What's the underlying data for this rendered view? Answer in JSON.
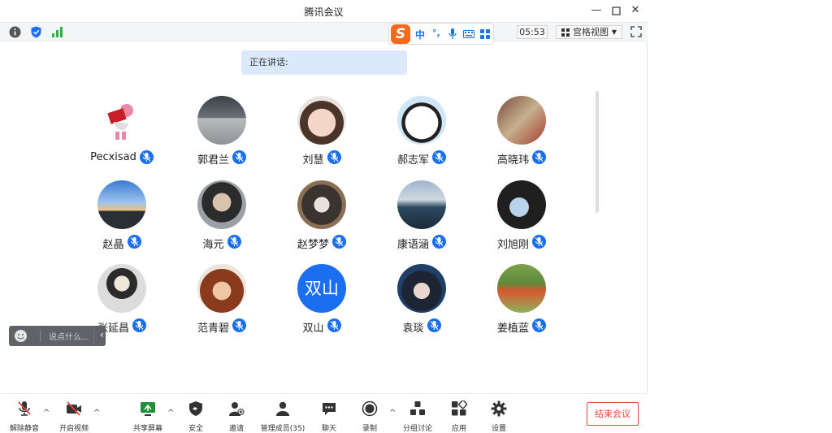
{
  "window": {
    "title": "腾讯会议"
  },
  "infobar": {
    "timer": "05:53",
    "view_label": "宫格视图"
  },
  "ime": {
    "logo": "S",
    "mode": "中",
    "punct": "°,"
  },
  "speaking": {
    "label": "正在讲话:"
  },
  "participants": [
    {
      "name": "Pecxisad",
      "avatar": "a0"
    },
    {
      "name": "郭君兰",
      "avatar": "a1"
    },
    {
      "name": "刘慧",
      "avatar": "a2"
    },
    {
      "name": "郝志军",
      "avatar": "a3"
    },
    {
      "name": "高晓玮",
      "avatar": "a4"
    },
    {
      "name": "赵晶",
      "avatar": "a5"
    },
    {
      "name": "海元",
      "avatar": "a6"
    },
    {
      "name": "赵梦梦",
      "avatar": "a7"
    },
    {
      "name": "康语涵",
      "avatar": "a8"
    },
    {
      "name": "刘旭刚",
      "avatar": "a9"
    },
    {
      "name": "张延昌",
      "avatar": "a10"
    },
    {
      "name": "范青碧",
      "avatar": "a11"
    },
    {
      "name": "双山",
      "avatar": "a12",
      "avatar_text": "双山"
    },
    {
      "name": "袁琰",
      "avatar": "a13"
    },
    {
      "name": "姜植蓝",
      "avatar": "a14"
    }
  ],
  "chat": {
    "placeholder": "说点什么..."
  },
  "toolbar": {
    "unmute": "解除静音",
    "video": "开启视频",
    "share": "共享屏幕",
    "security": "安全",
    "invite": "邀请",
    "members": "管理成员(35)",
    "chat": "聊天",
    "record": "录制",
    "breakout": "分组讨论",
    "apps": "应用",
    "settings": "设置",
    "end": "结束会议"
  },
  "colors": {
    "accent": "#1a6ff0",
    "end": "#e0473d",
    "ime": "#f26a1b"
  }
}
